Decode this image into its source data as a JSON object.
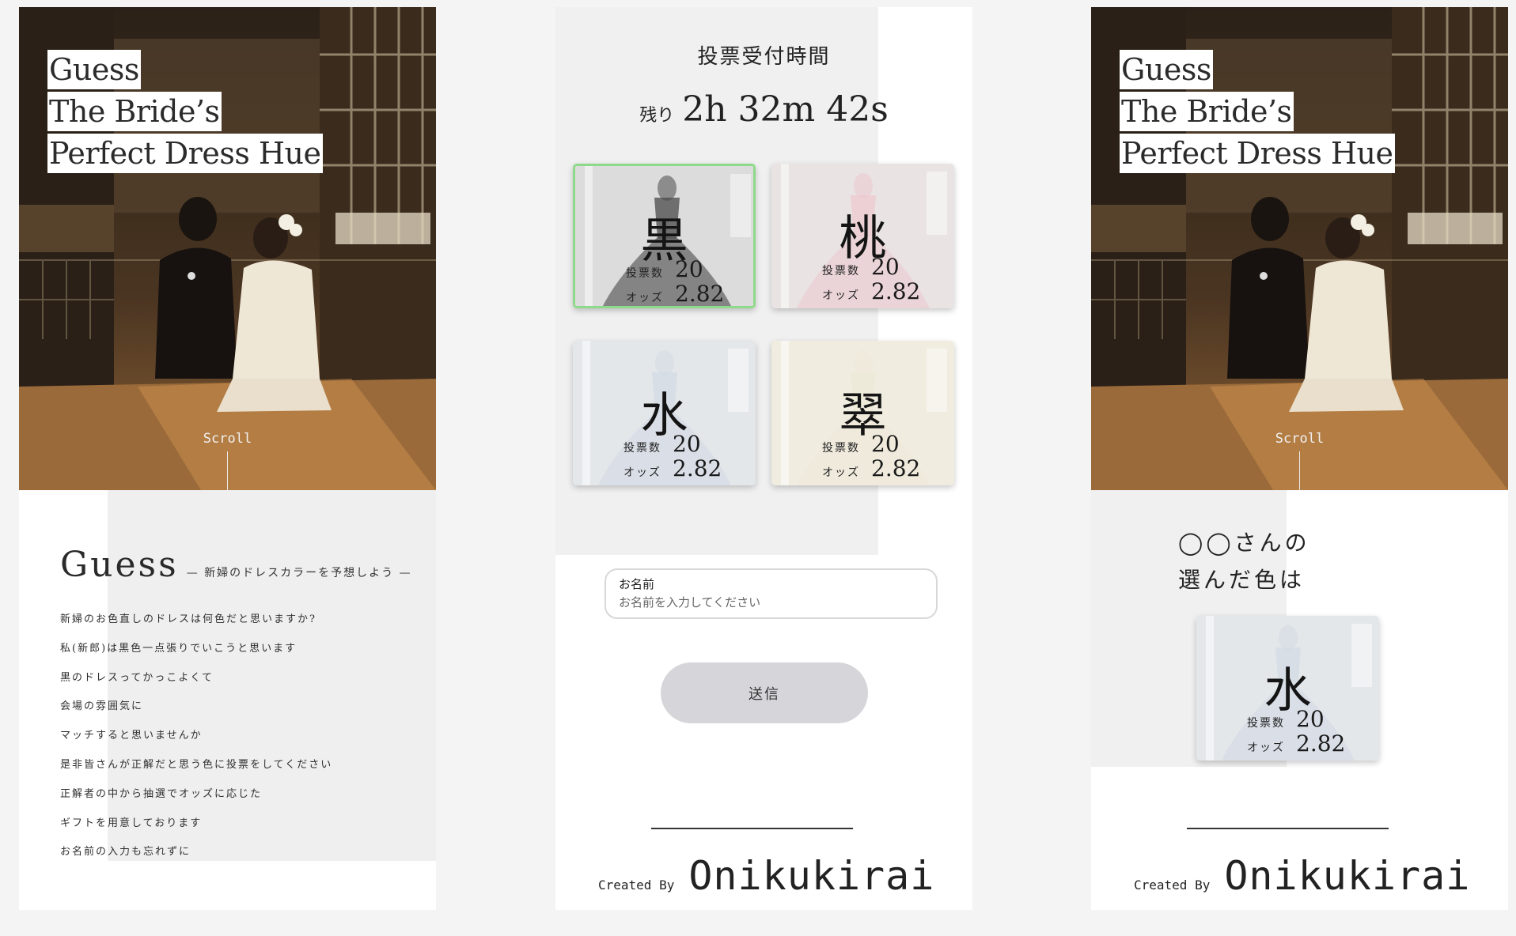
{
  "hero": {
    "title_lines": [
      "Guess",
      "The Bride’s",
      "Perfect Dress Hue"
    ],
    "scroll_label": "Scroll"
  },
  "intro": {
    "heading": "Guess",
    "subheading": "— 新婦のドレスカラーを予想しよう —",
    "lines": [
      "新婦のお色直しのドレスは何色だと思いますか?",
      "私(新郎)は黒色一点張りでいこうと思います",
      "黒のドレスってかっこよくて",
      "会場の雰囲気に",
      "マッチすると思いませんか",
      "是非皆さんが正解だと思う色に投票をしてください",
      "正解者の中から抽選でオッズに応じた",
      "ギフトを用意しております",
      "お名前の入力も忘れずに"
    ]
  },
  "voting": {
    "deadline_title": "投票受付時間",
    "countdown_prefix": "残り",
    "countdown_value": "2h 32m 42s",
    "vote_label": "投票数",
    "odds_label": "オッズ",
    "cards": [
      {
        "kanji": "黒",
        "votes": "20",
        "odds": "2.82",
        "selected": true,
        "dress_color": "#4a4a4a",
        "bg_color": "#dcdcdc"
      },
      {
        "kanji": "桃",
        "votes": "20",
        "odds": "2.82",
        "selected": false,
        "dress_color": "#ecc9cf",
        "bg_color": "#e9e3e3"
      },
      {
        "kanji": "水",
        "votes": "20",
        "odds": "2.82",
        "selected": false,
        "dress_color": "#d3dbe4",
        "bg_color": "#e4e7ea"
      },
      {
        "kanji": "翠",
        "votes": "20",
        "odds": "2.82",
        "selected": false,
        "dress_color": "#eeead8",
        "bg_color": "#f0ece0"
      }
    ]
  },
  "form": {
    "name_label": "お名前",
    "name_placeholder": "お名前を入力してください",
    "submit_label": "送信"
  },
  "footer": {
    "created_by": "Created By",
    "brand": "Onikukirai"
  },
  "result": {
    "heading_line1": "◯◯さんの",
    "heading_line2": "選んだ色は",
    "card": {
      "kanji": "水",
      "votes": "20",
      "odds": "2.82",
      "dress_color": "#d3dbe4",
      "bg_color": "#e4e7ea"
    }
  },
  "colors": {
    "selected_border": "#8fd98a",
    "button_bg": "#d6d6da"
  }
}
